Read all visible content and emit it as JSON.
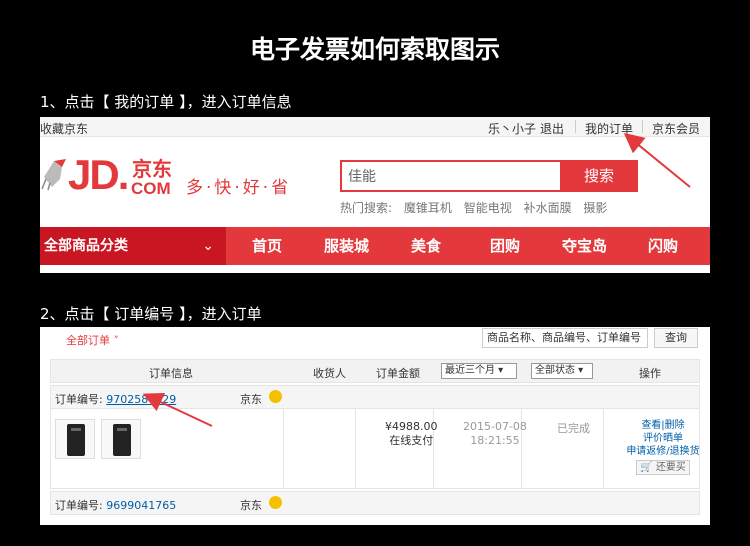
{
  "title": "电子发票如何索取图示",
  "step1": "1、点击【 我的订单 】，进入订单信息",
  "step2": "2、点击【 订单编号 】，进入订单",
  "topbar": {
    "favorite": "收藏京东",
    "user": "乐丶小子",
    "logout": "退出",
    "my_orders": "我的订单",
    "vip": "京东会员"
  },
  "logo": {
    "jd": "JD.",
    "cn": "京东",
    "com": "COM",
    "slogan": "多·快·好·省"
  },
  "search": {
    "value": "佳能",
    "button": "搜索",
    "hot_label": "热门搜索:",
    "hot": [
      "魔锥耳机",
      "智能电视",
      "补水面膜",
      "摄影"
    ]
  },
  "nav": {
    "category": "全部商品分类",
    "items": [
      "首页",
      "服装城",
      "美食",
      "团购",
      "夺宝岛",
      "闪购"
    ]
  },
  "orders": {
    "all_orders": "全部订单",
    "search_placeholder": "商品名称、商品编号、订单编号",
    "query": "查询",
    "headers": {
      "info": "订单信息",
      "receiver": "收货人",
      "amount": "订单金额",
      "period": "最近三个月",
      "status": "全部状态",
      "ops": "操作"
    },
    "order_label": "订单编号:",
    "shop": "京东",
    "order1": {
      "number": "9702586129",
      "amount": "¥4988.00",
      "pay": "在线支付",
      "date": "2015-07-08",
      "time": "18:21:55",
      "status": "已完成",
      "op1": "查看|删除",
      "op2": "评价晒单",
      "op3": "申请返修/退换货",
      "rebuy": "还要买"
    },
    "order2": {
      "number": "9699041765"
    }
  },
  "colors": {
    "brand_red": "#e4393c",
    "link_blue": "#005ea7"
  }
}
